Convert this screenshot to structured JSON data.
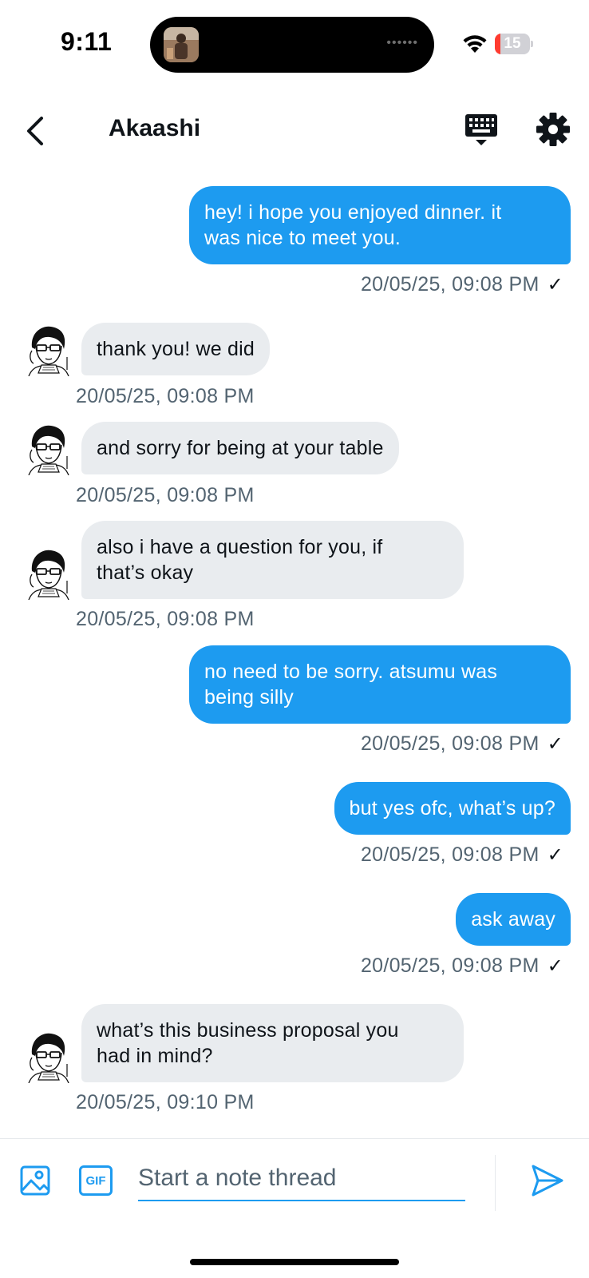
{
  "status_bar": {
    "time": "9:11",
    "battery_level": "15",
    "battery_fraction": 0.15,
    "island_dots": "••••••"
  },
  "header": {
    "title": "Akaashi",
    "icons": {
      "back": "chevron-left-icon",
      "keyboard": "keyboard-icon",
      "settings": "gear-icon"
    }
  },
  "messages": [
    {
      "direction": "out",
      "lines": [
        "hey! i hope you enjoyed dinner. it",
        "was nice to meet you."
      ],
      "timestamp": "20/05/25, 09:08 PM",
      "read": true
    },
    {
      "direction": "in",
      "lines": [
        "thank you! we did"
      ],
      "timestamp": "20/05/25, 09:08 PM"
    },
    {
      "direction": "in",
      "lines": [
        "and sorry for being at your table"
      ],
      "timestamp": "20/05/25, 09:08 PM"
    },
    {
      "direction": "in",
      "lines": [
        "also i have a question for you, if",
        "that’s okay"
      ],
      "timestamp": "20/05/25, 09:08 PM"
    },
    {
      "direction": "out",
      "lines": [
        "no need to be sorry. atsumu was",
        "being silly"
      ],
      "timestamp": "20/05/25, 09:08 PM",
      "read": true
    },
    {
      "direction": "out",
      "lines": [
        "but yes ofc, what’s up?"
      ],
      "timestamp": "20/05/25, 09:08 PM",
      "read": true
    },
    {
      "direction": "out",
      "lines": [
        "ask away"
      ],
      "timestamp": "20/05/25, 09:08 PM",
      "read": true
    },
    {
      "direction": "in",
      "lines": [
        "what’s this business proposal you",
        "had in mind?"
      ],
      "timestamp": "20/05/25, 09:10 PM"
    }
  ],
  "composer": {
    "placeholder": "Start a note thread",
    "gif_label": "GIF",
    "icons": {
      "media": "image-icon",
      "gif": "gif-icon",
      "send": "send-icon"
    }
  },
  "colors": {
    "accent": "#1d9bf0",
    "incoming_bubble": "#e9ecef",
    "timestamp": "#536471",
    "battery_low": "#ff3b30"
  }
}
